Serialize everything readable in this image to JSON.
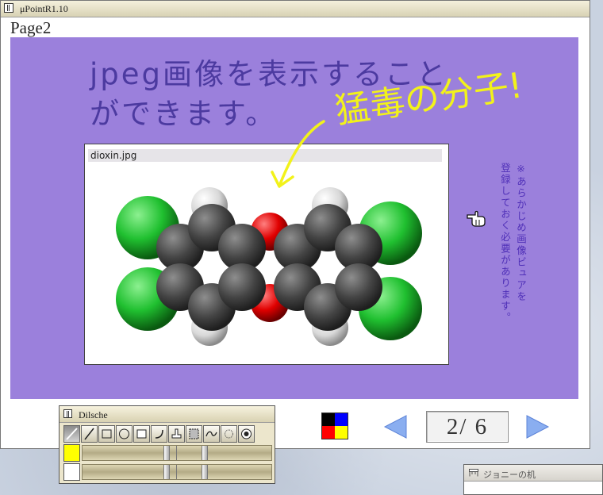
{
  "window": {
    "title": "μPointR1.10"
  },
  "page": {
    "label": "Page2"
  },
  "slide": {
    "headline_line1": "jpeg画像を表示すること",
    "headline_line2": "ができます。",
    "handwritten_note": "猛毒の分子!",
    "image_caption": "dioxin.jpg",
    "side_note_line1": "※あらかじめ画像ビュアを",
    "side_note_line2": "登録しておく必要があります。",
    "colors": {
      "background": "#9b80dc",
      "headline": "#4c3aa0",
      "annotation": "#f2f21a",
      "side_note": "#5030b8"
    }
  },
  "navigation": {
    "page_indicator": "2/ 6",
    "prev_icon": "left-triangle-icon",
    "next_icon": "right-triangle-icon"
  },
  "palette": {
    "colors": [
      "#000000",
      "#0000ff",
      "#ff0000",
      "#ffff00"
    ]
  },
  "tool_window": {
    "title": "Dilsche",
    "tools": [
      "pen-icon",
      "line-icon",
      "rectangle-icon",
      "circle-icon",
      "filled-rectangle-icon",
      "arc-icon",
      "stamp-icon",
      "select-icon",
      "image-icon",
      "eraser-icon",
      "record-icon"
    ],
    "colors": [
      "#ffff00",
      "#ffffff"
    ]
  },
  "background_window": {
    "title": "ジョニーの机"
  }
}
